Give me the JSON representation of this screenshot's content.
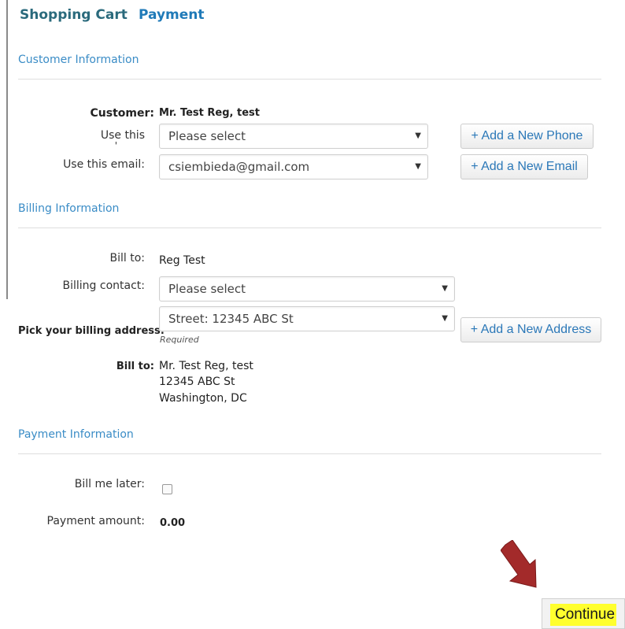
{
  "tabs": [
    "Shopping Cart",
    "Payment"
  ],
  "customer_section": {
    "title": "Customer Information",
    "customer_label": "Customer:",
    "customer_value": "Mr. Test Reg, test",
    "phone_label": "Use this",
    "phone_label_cont": "'",
    "phone_select": "Please select",
    "add_phone": "+ Add a New Phone",
    "email_label": "Use this email:",
    "email_select": "csiembieda@gmail.com",
    "add_email": "+ Add a New Email"
  },
  "billing_section": {
    "title": "Billing Information",
    "bill_to_label": "Bill to:",
    "bill_to_value": "Reg Test",
    "contact_label": "Billing contact:",
    "contact_select": "Please select",
    "address_label": "Pick your billing address:",
    "address_select": "Street: 12345 ABC St",
    "required": "Required",
    "add_address": "+ Add a New Address",
    "bill_to_label2": "Bill to:",
    "address_lines": [
      "Mr. Test Reg, test",
      "12345 ABC St",
      "Washington, DC"
    ]
  },
  "payment_section": {
    "title": "Payment Information",
    "bill_later_label": "Bill me later:",
    "amount_label": "Payment amount:",
    "amount_value": "0.00"
  },
  "continue_label": "Continue",
  "colors": {
    "accent": "#3a8cc6",
    "highlight": "#ffff2e",
    "arrow": "#a32a2a"
  }
}
